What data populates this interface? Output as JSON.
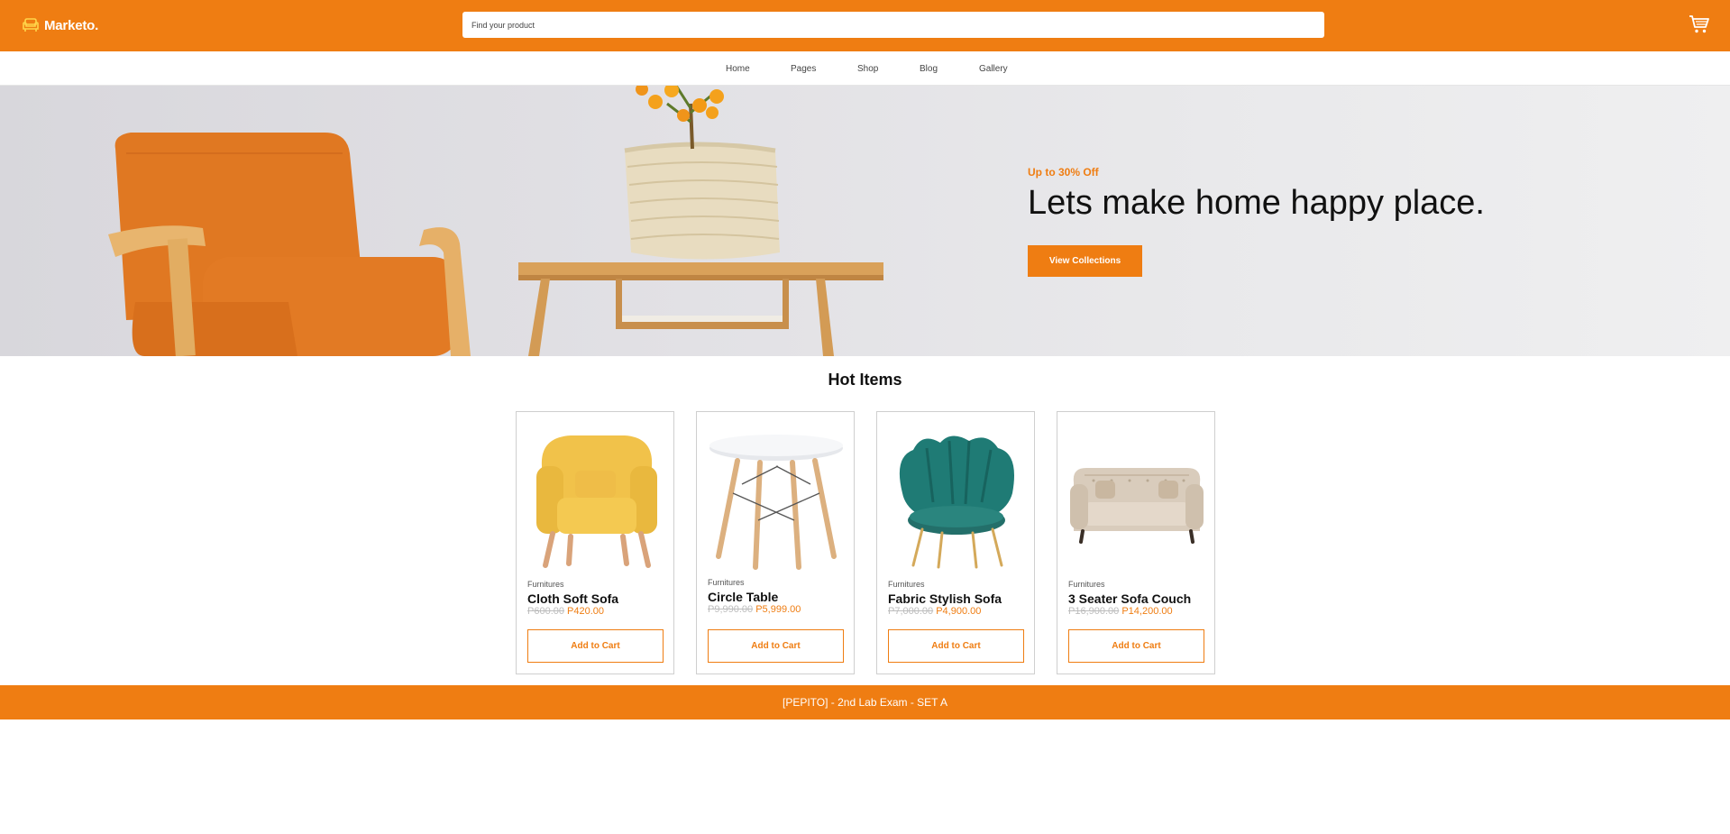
{
  "header": {
    "brand": "Marketo.",
    "logo_icon": "sofa-icon",
    "cart_icon": "cart-icon",
    "search": {
      "placeholder": "Find your product",
      "value": ""
    }
  },
  "nav": {
    "items": [
      "Home",
      "Pages",
      "Shop",
      "Blog",
      "Gallery"
    ]
  },
  "hero": {
    "offer": "Up to 30% Off",
    "title": "Lets make home happy place.",
    "button": "View Collections"
  },
  "section": {
    "title": "Hot Items"
  },
  "products": [
    {
      "category": "Furnitures",
      "name": "Cloth Soft Sofa",
      "old_price": "P600.00",
      "price": "P420.00",
      "button": "Add to Cart",
      "image_icon": "yellow-armchair-image"
    },
    {
      "category": "Furnitures",
      "name": "Circle Table",
      "old_price": "P9,990.00",
      "price": "P5,999.00",
      "button": "Add to Cart",
      "image_icon": "round-table-image"
    },
    {
      "category": "Furnitures",
      "name": "Fabric Stylish Sofa",
      "old_price": "P7,000.00",
      "price": "P4,900.00",
      "button": "Add to Cart",
      "image_icon": "teal-shell-chair-image"
    },
    {
      "category": "Furnitures",
      "name": "3 Seater Sofa Couch",
      "old_price": "P16,900.00",
      "price": "P14,200.00",
      "button": "Add to Cart",
      "image_icon": "beige-sofa-image"
    }
  ],
  "footer": {
    "text": "[PEPITO] - 2nd Lab Exam - SET A"
  },
  "colors": {
    "accent": "#ef7d12",
    "muted": "#bdbdbd",
    "text": "#111111"
  }
}
